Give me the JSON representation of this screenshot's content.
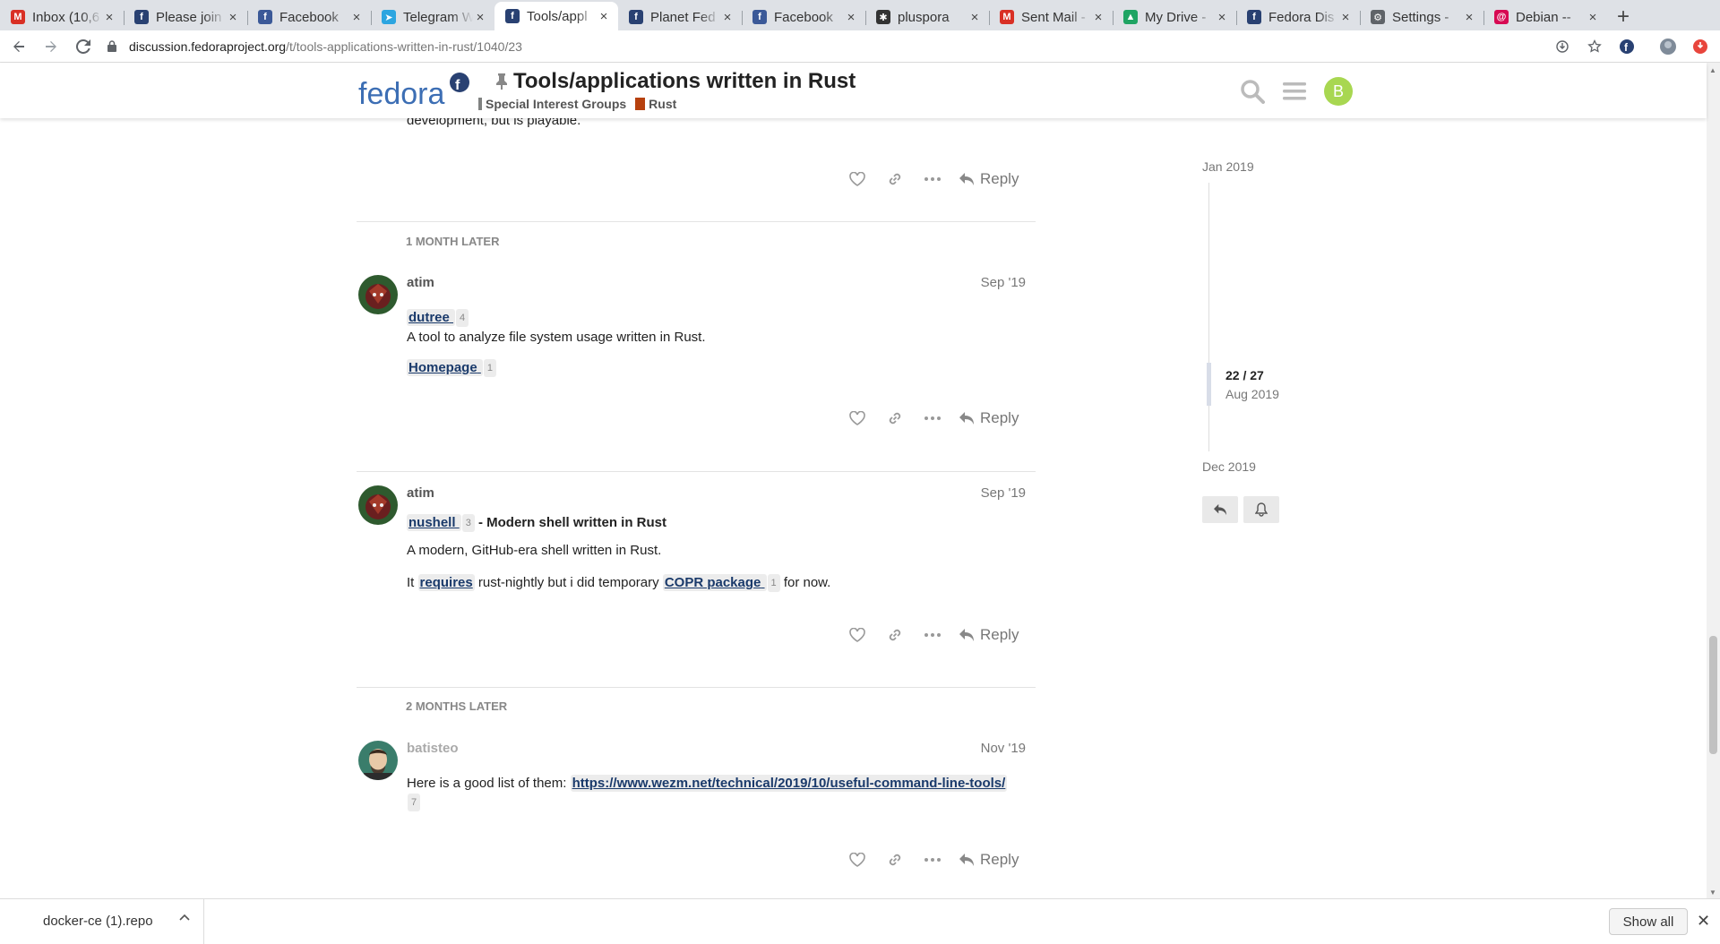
{
  "browser": {
    "tabs": [
      {
        "title": "Inbox (10,6",
        "favicon": "gmail-icon",
        "color": "#d93025",
        "glyph": "M"
      },
      {
        "title": "Please join",
        "favicon": "fedora-icon",
        "color": "#294172",
        "glyph": "f"
      },
      {
        "title": "Facebook",
        "favicon": "facebook-icon",
        "color": "#3b5998",
        "glyph": "f"
      },
      {
        "title": "Telegram W",
        "favicon": "telegram-icon",
        "color": "#2ca5e0",
        "glyph": "➤"
      },
      {
        "title": "Tools/appl",
        "favicon": "fedora-icon",
        "color": "#294172",
        "glyph": "f",
        "active": true
      },
      {
        "title": "Planet Fed",
        "favicon": "fedora-icon",
        "color": "#294172",
        "glyph": "f"
      },
      {
        "title": "Facebook",
        "favicon": "facebook-icon",
        "color": "#3b5998",
        "glyph": "f"
      },
      {
        "title": "pluspora",
        "favicon": "diaspora-icon",
        "color": "#333333",
        "glyph": "✱"
      },
      {
        "title": "Sent Mail -",
        "favicon": "gmail-icon",
        "color": "#d93025",
        "glyph": "M"
      },
      {
        "title": "My Drive -",
        "favicon": "google-drive-icon",
        "color": "#1fa463",
        "glyph": "▲"
      },
      {
        "title": "Fedora Dis",
        "favicon": "fedora-icon",
        "color": "#294172",
        "glyph": "f"
      },
      {
        "title": "Settings -",
        "favicon": "gear-icon",
        "color": "#5f6368",
        "glyph": "⚙"
      },
      {
        "title": "Debian --",
        "favicon": "debian-icon",
        "color": "#d70a53",
        "glyph": "@"
      }
    ],
    "url_host": "discussion.fedoraproject.org",
    "url_path": "/t/tools-applications-written-in-rust/1040/23"
  },
  "header": {
    "logo_text": "fedora",
    "title": "Tools/applications written in Rust",
    "categories": [
      {
        "label": "Special Interest Groups",
        "color": "#808281"
      },
      {
        "label": "Rust",
        "color": "#b7410e"
      }
    ],
    "avatar_letter": "B"
  },
  "posts": {
    "partial_text": "development, but is playable.",
    "gap1": "1 MONTH LATER",
    "gap2": "2 MONTHS LATER",
    "p22": {
      "author": "atim",
      "date": "Sep '19",
      "link_label": "dutree",
      "link_count": "4",
      "description": "A tool to analyze file system usage written in Rust.",
      "homepage_label": "Homepage",
      "homepage_count": "1"
    },
    "p23": {
      "author": "atim",
      "date": "Sep '19",
      "link_label": "nushell",
      "link_count": "3",
      "heading_suffix": " - Modern shell written in Rust",
      "description": "A modern, GitHub-era shell written in Rust.",
      "t1": "It ",
      "requires_label": "requires",
      "t2": " rust-nightly but i did temporary ",
      "copr_label": "COPR package",
      "copr_count": "1",
      "t3": " for now."
    },
    "p24": {
      "author": "batisteo",
      "date": "Nov '19",
      "text": "Here is a good list of them: ",
      "link": "https://www.wezm.net/technical/2019/10/useful-command-line-tools/",
      "link_count": "7"
    },
    "reply_label": "Reply"
  },
  "timeline": {
    "start": "Jan 2019",
    "position": "22 / 27",
    "current_month": "Aug 2019",
    "end": "Dec 2019"
  },
  "downloads": {
    "file": "docker-ce (1).repo",
    "show_all": "Show all"
  }
}
